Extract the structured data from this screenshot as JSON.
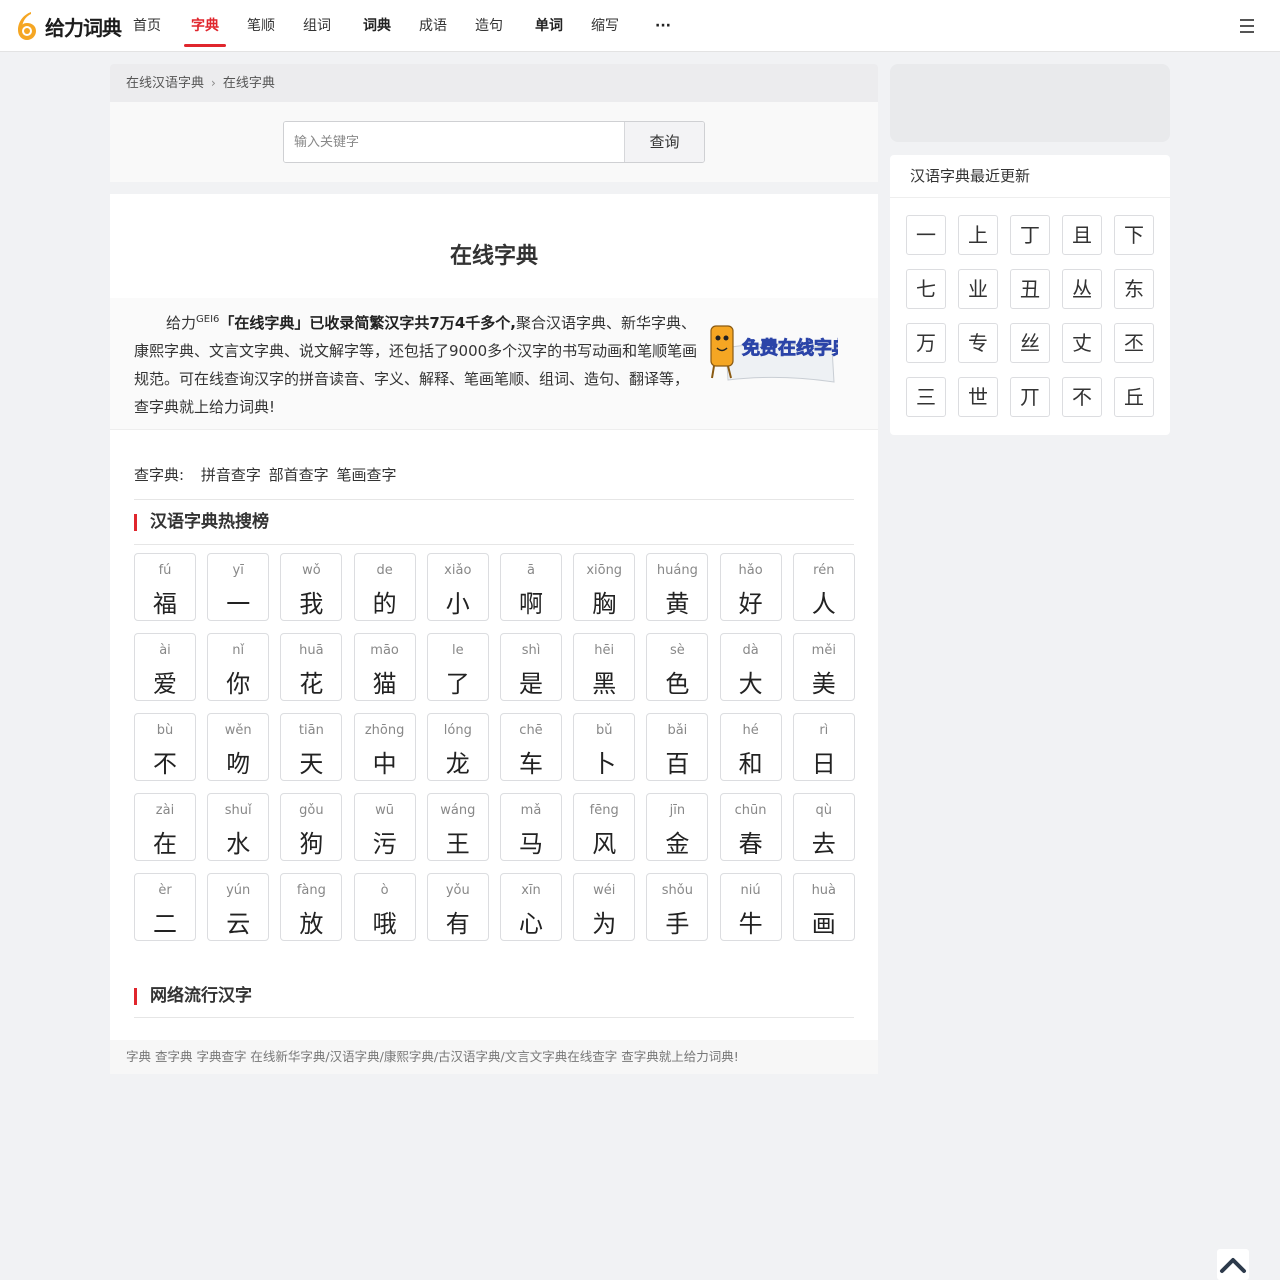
{
  "nav": {
    "logo_text": "给力词典",
    "items": [
      {
        "label": "首页"
      },
      {
        "label": "字典"
      },
      {
        "label": "笔顺"
      },
      {
        "label": "组词"
      },
      {
        "label": "词典"
      },
      {
        "label": "成语"
      },
      {
        "label": "造句"
      },
      {
        "label": "单词"
      },
      {
        "label": "缩写"
      },
      {
        "label": "···"
      }
    ]
  },
  "breadcrumb": {
    "items": [
      "在线汉语字典",
      "在线字典"
    ]
  },
  "search": {
    "placeholder": "输入关键字",
    "button_label": "查询"
  },
  "main": {
    "title": "在线字典",
    "intro": {
      "lead": "给力",
      "sup": "GEI6",
      "bold": "「在线字典」已收录简繁汉字共7万4千多个,",
      "rest": "聚合汉语字典、新华字典、康熙字典、文言文字典、说文解字等，还包括了9000多个汉字的书写动画和笔顺笔画规范。可在线查询汉字的拼音读音、字义、解释、笔画笔顺、组词、造句、翻译等，查字典就上给力词典!"
    },
    "promo_text": "免费在线字典",
    "lookup": {
      "label": "查字典:",
      "links": [
        "拼音查字",
        "部首查字",
        "笔画查字"
      ]
    },
    "hot_title": "汉语字典热搜榜",
    "hot": [
      {
        "py": "fú",
        "ch": "福"
      },
      {
        "py": "yī",
        "ch": "一"
      },
      {
        "py": "wǒ",
        "ch": "我"
      },
      {
        "py": "de",
        "ch": "的"
      },
      {
        "py": "xiǎo",
        "ch": "小"
      },
      {
        "py": "ā",
        "ch": "啊"
      },
      {
        "py": "xiōng",
        "ch": "胸"
      },
      {
        "py": "huáng",
        "ch": "黄"
      },
      {
        "py": "hǎo",
        "ch": "好"
      },
      {
        "py": "rén",
        "ch": "人"
      },
      {
        "py": "ài",
        "ch": "爱"
      },
      {
        "py": "nǐ",
        "ch": "你"
      },
      {
        "py": "huā",
        "ch": "花"
      },
      {
        "py": "māo",
        "ch": "猫"
      },
      {
        "py": "le",
        "ch": "了"
      },
      {
        "py": "shì",
        "ch": "是"
      },
      {
        "py": "hēi",
        "ch": "黑"
      },
      {
        "py": "sè",
        "ch": "色"
      },
      {
        "py": "dà",
        "ch": "大"
      },
      {
        "py": "měi",
        "ch": "美"
      },
      {
        "py": "bù",
        "ch": "不"
      },
      {
        "py": "wěn",
        "ch": "吻"
      },
      {
        "py": "tiān",
        "ch": "天"
      },
      {
        "py": "zhōng",
        "ch": "中"
      },
      {
        "py": "lóng",
        "ch": "龙"
      },
      {
        "py": "chē",
        "ch": "车"
      },
      {
        "py": "bǔ",
        "ch": "卜"
      },
      {
        "py": "bǎi",
        "ch": "百"
      },
      {
        "py": "hé",
        "ch": "和"
      },
      {
        "py": "rì",
        "ch": "日"
      },
      {
        "py": "zài",
        "ch": "在"
      },
      {
        "py": "shuǐ",
        "ch": "水"
      },
      {
        "py": "gǒu",
        "ch": "狗"
      },
      {
        "py": "wū",
        "ch": "污"
      },
      {
        "py": "wáng",
        "ch": "王"
      },
      {
        "py": "mǎ",
        "ch": "马"
      },
      {
        "py": "fēng",
        "ch": "风"
      },
      {
        "py": "jīn",
        "ch": "金"
      },
      {
        "py": "chūn",
        "ch": "春"
      },
      {
        "py": "qù",
        "ch": "去"
      },
      {
        "py": "èr",
        "ch": "二"
      },
      {
        "py": "yún",
        "ch": "云"
      },
      {
        "py": "fàng",
        "ch": "放"
      },
      {
        "py": "ò",
        "ch": "哦"
      },
      {
        "py": "yǒu",
        "ch": "有"
      },
      {
        "py": "xīn",
        "ch": "心"
      },
      {
        "py": "wéi",
        "ch": "为"
      },
      {
        "py": "shǒu",
        "ch": "手"
      },
      {
        "py": "niú",
        "ch": "牛"
      },
      {
        "py": "huà",
        "ch": "画"
      }
    ],
    "popular_title": "网络流行汉字"
  },
  "footer": {
    "text": "字典 查字典 字典查字 在线新华字典/汉语字典/康熙字典/古汉语字典/文言文字典在线查字 查字典就上给力词典!"
  },
  "sidebar": {
    "title": "汉语字典最近更新",
    "chars": [
      "一",
      "上",
      "丁",
      "且",
      "下",
      "七",
      "业",
      "丑",
      "丛",
      "东",
      "万",
      "专",
      "丝",
      "丈",
      "丕",
      "三",
      "世",
      "丌",
      "不",
      "丘"
    ]
  },
  "colors": {
    "accent": "#e0262d",
    "logo_orange": "#f5a623",
    "page_bg": "#f1f2f4"
  },
  "icons": [
    "logo-icon",
    "breadcrumb-chevron-icon",
    "menu-icon",
    "back-to-top-icon"
  ]
}
